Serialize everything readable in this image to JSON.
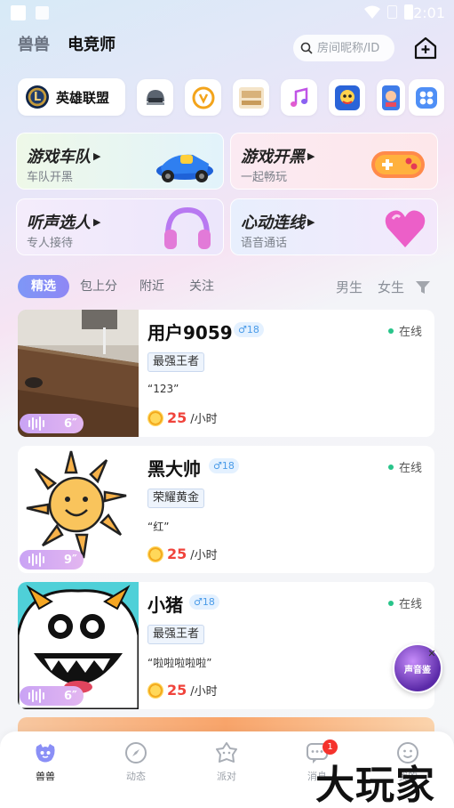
{
  "status_bar": {
    "time": "2:01"
  },
  "header": {
    "tabs": [
      {
        "label": "兽兽",
        "active": false
      },
      {
        "label": "电竞师",
        "active": true
      }
    ],
    "search_placeholder": "房间昵称/ID"
  },
  "games": {
    "selected": "英雄联盟",
    "others": [
      "pubg-helmet-icon",
      "overwatch-icon",
      "board-game-icon",
      "music-note-icon",
      "arena-game-icon",
      "mobile-game-icon",
      "more-apps-icon"
    ]
  },
  "categories": [
    {
      "title": "游戏车队",
      "subtitle": "车队开黑",
      "bg": "#e8f6fb"
    },
    {
      "title": "游戏开黑",
      "subtitle": "一起畅玩",
      "bg": "#fbe9f3"
    },
    {
      "title": "听声选人",
      "subtitle": "专人接待",
      "bg": "#eee9fb"
    },
    {
      "title": "心动连线",
      "subtitle": "语音通话",
      "bg": "#e7eefc"
    }
  ],
  "filters": {
    "tabs": [
      "精选",
      "包上分",
      "附近",
      "关注"
    ],
    "active": "精选",
    "gender": [
      "男生",
      "女生"
    ]
  },
  "users": [
    {
      "name": "用户9059",
      "gender": "♂18",
      "status": "在线",
      "rank": "最强王者",
      "quote": "“123”",
      "price": "25",
      "unit": "/小时",
      "voice": "6″"
    },
    {
      "name": "黑大帅",
      "gender": "♂18",
      "status": "在线",
      "rank": "荣耀黄金",
      "quote": "“红”",
      "price": "25",
      "unit": "/小时",
      "voice": "9″"
    },
    {
      "name": "小猪",
      "gender": "♂18",
      "status": "在线",
      "rank": "最强王者",
      "quote": "“啦啦啦啦啦”",
      "price": "25",
      "unit": "/小时",
      "voice": "6″"
    }
  ],
  "float_ad": {
    "text": "声音鉴"
  },
  "bottom_nav": [
    {
      "label": "兽兽",
      "icon": "beast-icon",
      "active": true
    },
    {
      "label": "动态",
      "icon": "compass-icon",
      "active": false
    },
    {
      "label": "派对",
      "icon": "party-icon",
      "active": false
    },
    {
      "label": "消息",
      "icon": "message-icon",
      "active": false,
      "badge": "1"
    },
    {
      "label": "我的",
      "icon": "profile-icon",
      "active": false
    }
  ],
  "watermark": "大玩家",
  "colors": {
    "accent": "#8a8ff6",
    "price": "#f0443c",
    "online": "#28c48a"
  }
}
